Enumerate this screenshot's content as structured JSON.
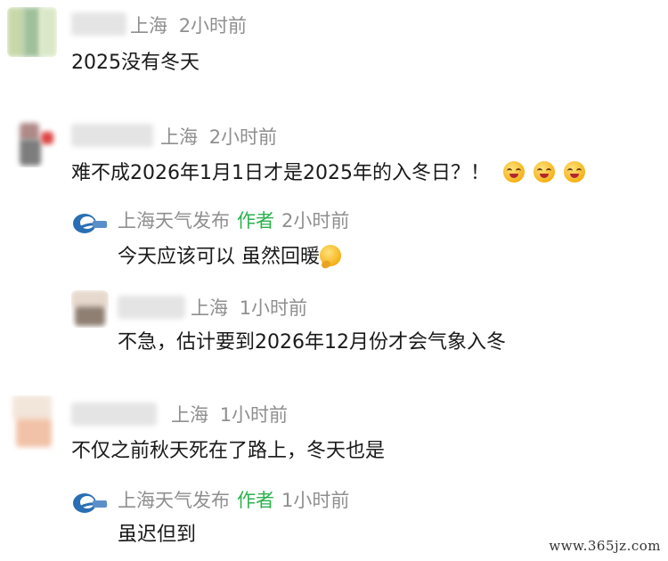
{
  "comments": [
    {
      "location": "上海",
      "time": "2小时前",
      "text": "2025没有冬天"
    },
    {
      "location": "上海",
      "time": "2小时前",
      "text": "难不成2026年1月1日才是2025年的入冬日？！",
      "replies": [
        {
          "author": "上海天气发布",
          "badge": "作者",
          "time": "2小时前",
          "text": "今天应该可以 虽然回暖"
        },
        {
          "location": "上海",
          "time": "1小时前",
          "text": "不急，估计要到2026年12月份才会气象入冬"
        }
      ]
    },
    {
      "location": "上海",
      "time": "1小时前",
      "text": "不仅之前秋天死在了路上，冬天也是",
      "replies": [
        {
          "author": "上海天气发布",
          "badge": "作者",
          "time": "1小时前",
          "text": "虽迟但到"
        }
      ]
    }
  ],
  "emoji": {
    "laugh_cry": "laugh-cry-emoji",
    "thinking": "thinking-emoji"
  },
  "watermark": "www.365jz.com",
  "colors": {
    "meta_gray": "#8f8f8f",
    "author_green": "#2bb24c",
    "text": "#1a1a1a"
  }
}
